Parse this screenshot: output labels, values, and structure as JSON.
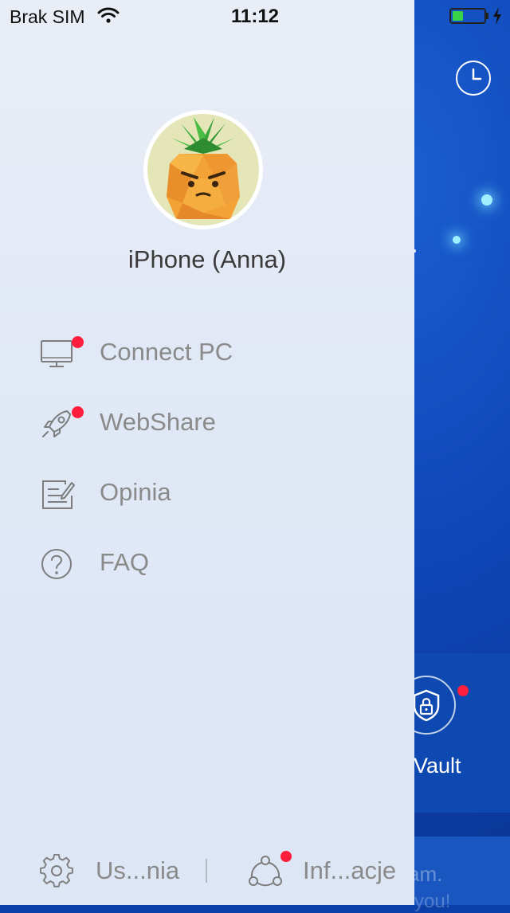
{
  "status_bar": {
    "carrier": "Brak SIM",
    "time": "11:12",
    "battery_level": 0.35,
    "battery_color": "#39d34a"
  },
  "drawer": {
    "device_name": "iPhone (Anna)",
    "avatar_icon": "pineapple-avatar",
    "menu": [
      {
        "label": "Connect PC",
        "icon": "monitor-icon",
        "badge": true
      },
      {
        "label": "WebShare",
        "icon": "rocket-icon",
        "badge": true
      },
      {
        "label": "Opinia",
        "icon": "feedback-icon",
        "badge": false
      },
      {
        "label": "FAQ",
        "icon": "question-icon",
        "badge": false
      }
    ],
    "footer": {
      "settings_label": "Us...nia",
      "info_label": "Inf...acje",
      "info_badge": true
    }
  },
  "background": {
    "vault_label": "Eit Vault",
    "faint_text_1": "am.",
    "faint_text_2": "you!",
    "accent_color": "#0d49b0",
    "badge_color": "#ff1f3d"
  }
}
